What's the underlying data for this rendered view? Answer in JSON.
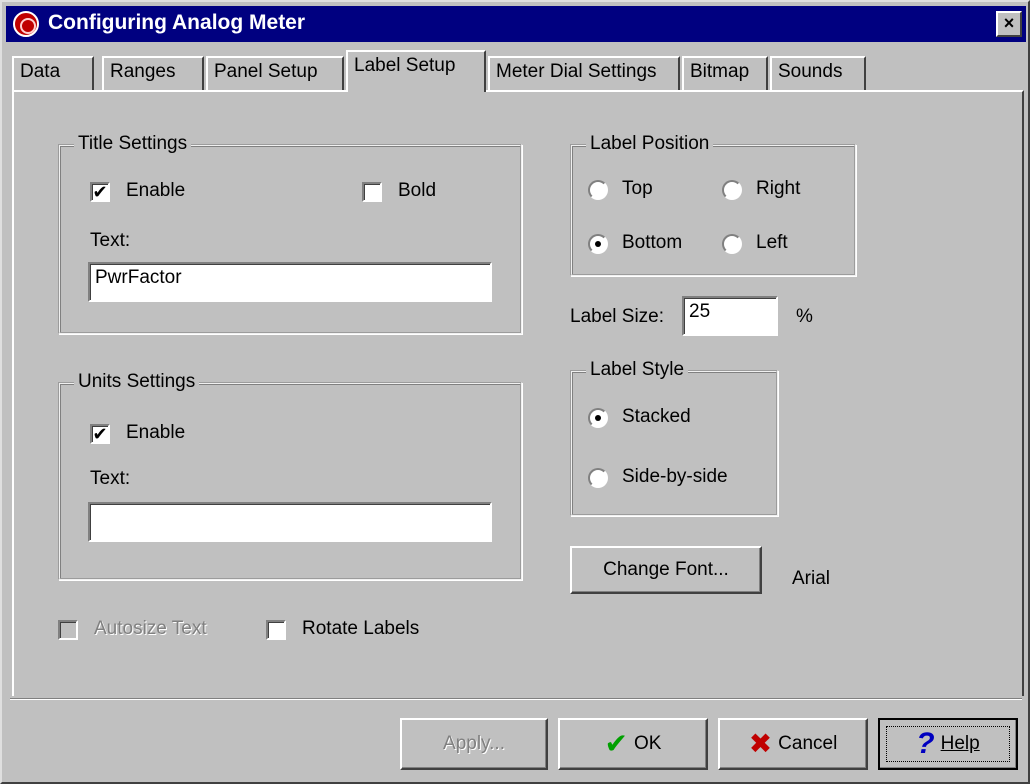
{
  "window": {
    "title": "Configuring Analog Meter",
    "close_label": "×"
  },
  "tabs": [
    {
      "label": "Data"
    },
    {
      "label": "Ranges"
    },
    {
      "label": "Panel Setup"
    },
    {
      "label": "Label Setup"
    },
    {
      "label": "Meter Dial Settings"
    },
    {
      "label": "Bitmap"
    },
    {
      "label": "Sounds"
    }
  ],
  "active_tab": "Label Setup",
  "title_settings": {
    "group_label": "Title Settings",
    "enable_label": "Enable",
    "enable_checked": true,
    "bold_label": "Bold",
    "bold_checked": false,
    "text_label": "Text:",
    "text_value": "PwrFactor"
  },
  "units_settings": {
    "group_label": "Units Settings",
    "enable_label": "Enable",
    "enable_checked": true,
    "text_label": "Text:",
    "text_value": ""
  },
  "autosize": {
    "label": "Autosize Text",
    "checked": false,
    "disabled": true
  },
  "rotate": {
    "label": "Rotate Labels",
    "checked": false
  },
  "label_position": {
    "group_label": "Label Position",
    "options": [
      "Top",
      "Right",
      "Bottom",
      "Left"
    ],
    "selected": "Bottom"
  },
  "label_size": {
    "label": "Label Size:",
    "value": "25",
    "unit": "%"
  },
  "label_style": {
    "group_label": "Label Style",
    "options": [
      "Stacked",
      "Side-by-side"
    ],
    "selected": "Stacked"
  },
  "font": {
    "button_label": "Change Font...",
    "current_font": "Arial"
  },
  "buttons": {
    "apply": "Apply...",
    "ok": "OK",
    "cancel": "Cancel",
    "help": "Help"
  },
  "colors": {
    "titlebar": "#000080",
    "face": "#c0c0c0",
    "ok_check": "#00a000",
    "cancel_x": "#c00000",
    "help_q": "#0000c0"
  }
}
